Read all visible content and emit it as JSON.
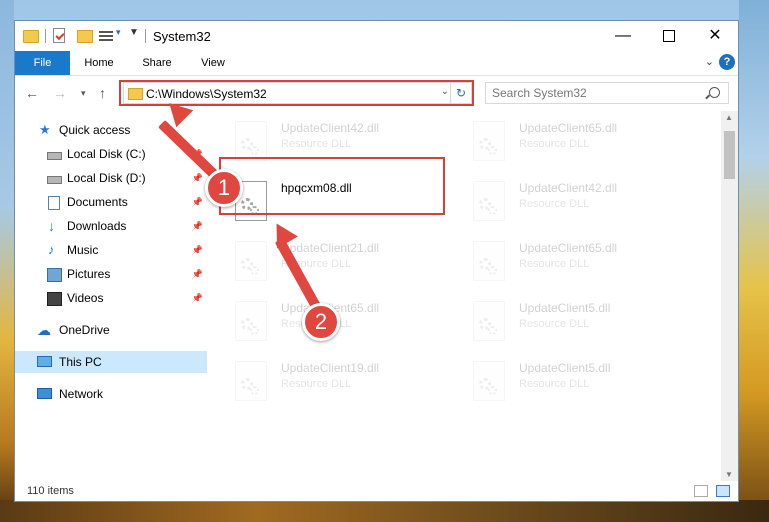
{
  "window": {
    "title": "System32",
    "controls": {
      "minimize": "—",
      "maximize": "",
      "close": "✕"
    }
  },
  "ribbon": {
    "tabs": [
      "File",
      "Home",
      "Share",
      "View"
    ],
    "help": "?"
  },
  "nav": {
    "address": "C:\\Windows\\System32",
    "search_placeholder": "Search System32"
  },
  "sidebar": {
    "items": [
      {
        "label": "Quick access",
        "icon": "star-icon",
        "pinned": false
      },
      {
        "label": "Local Disk (C:)",
        "icon": "disk-icon",
        "pinned": true
      },
      {
        "label": "Local Disk (D:)",
        "icon": "disk-icon",
        "pinned": true
      },
      {
        "label": "Documents",
        "icon": "documents-icon",
        "pinned": true
      },
      {
        "label": "Downloads",
        "icon": "downloads-icon",
        "pinned": true
      },
      {
        "label": "Music",
        "icon": "music-icon",
        "pinned": true
      },
      {
        "label": "Pictures",
        "icon": "pictures-icon",
        "pinned": true
      },
      {
        "label": "Videos",
        "icon": "videos-icon",
        "pinned": true
      },
      {
        "label": "OneDrive",
        "icon": "onedrive-icon",
        "pinned": false
      },
      {
        "label": "This PC",
        "icon": "this-pc-icon",
        "pinned": false,
        "selected": true
      },
      {
        "label": "Network",
        "icon": "network-icon",
        "pinned": false
      }
    ]
  },
  "files": {
    "highlighted": {
      "name": "hpqcxm08.dll"
    },
    "background": [
      {
        "name": "UpdateClient42.dll",
        "type": "Resource DLL"
      },
      {
        "name": "UpdateClient65.dll",
        "type": "Resource DLL"
      },
      {
        "name": "UpdateClient42.dll",
        "type": "Resource DLL"
      },
      {
        "name": "UpdateClient21.dll",
        "type": "Resource DLL"
      },
      {
        "name": "UpdateClient65.dll",
        "type": "Resource DLL"
      },
      {
        "name": "UpdateClient65.dll",
        "type": "Resource DLL"
      },
      {
        "name": "UpdateClient5.dll",
        "type": "Resource DLL"
      },
      {
        "name": "UpdateClient19.dll",
        "type": "Resource DLL"
      },
      {
        "name": "UpdateClient5.dll",
        "type": "Resource DLL"
      }
    ]
  },
  "status": {
    "item_count": "110 items"
  },
  "annotations": {
    "step1": "1",
    "step2": "2"
  },
  "colors": {
    "accent": "#1979ca",
    "highlight": "#d6403a",
    "selected": "#cce8ff"
  }
}
